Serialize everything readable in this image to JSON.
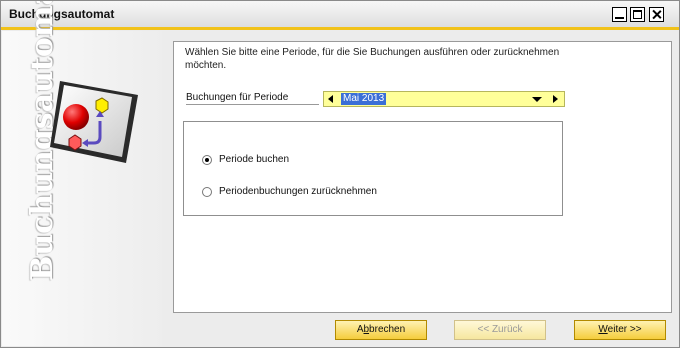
{
  "window": {
    "title": "Buchungsautomat"
  },
  "sidebar": {
    "vertical_text": "Buchungsautomat",
    "logo_icon": "posting-automation-icon"
  },
  "main": {
    "instruction": "Wählen Sie bitte eine Periode, für die Sie Buchungen ausführen oder zurücknehmen möchten.",
    "period_label": "Buchungen für Periode",
    "period_value": "Mai 2013",
    "options": [
      {
        "label": "Periode buchen",
        "selected": true
      },
      {
        "label": "Periodenbuchungen zurücknehmen",
        "selected": false
      }
    ]
  },
  "buttons": {
    "cancel": {
      "first": "A",
      "underline": "b",
      "rest": "brechen"
    },
    "back": {
      "label": "<< Zurück"
    },
    "next": {
      "underline": "W",
      "rest": "eiter >>"
    }
  },
  "colors": {
    "accent": "#f1c21a",
    "field_bg": "#ffff99",
    "selection": "#3b6fd6",
    "button_bg": "#f5cd3c"
  }
}
